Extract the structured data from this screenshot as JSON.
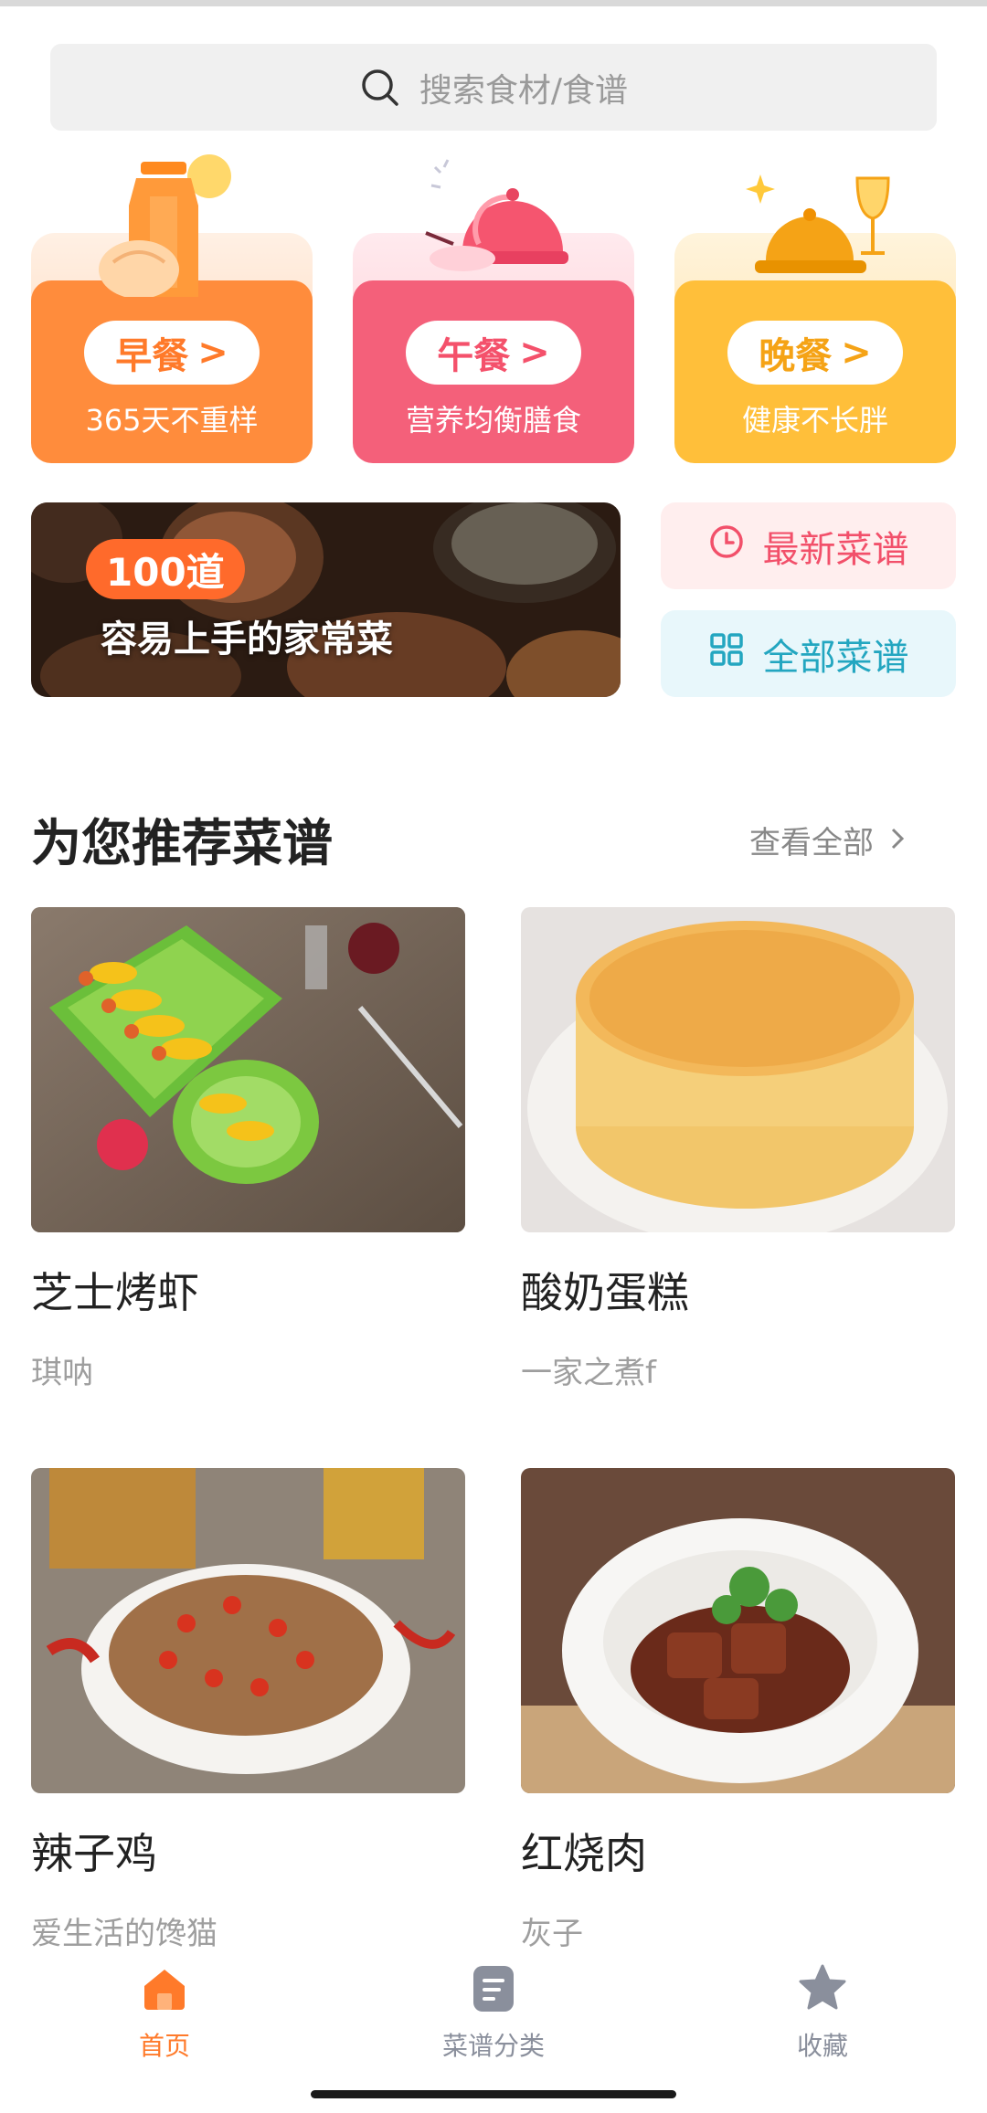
{
  "search": {
    "placeholder": "搜索食材/食谱"
  },
  "meals": [
    {
      "label": "早餐",
      "subtitle": "365天不重样",
      "color": "#ff8c3c",
      "text_color": "#ff7a2a"
    },
    {
      "label": "午餐",
      "subtitle": "营养均衡膳食",
      "color": "#f4607a",
      "text_color": "#f4516b"
    },
    {
      "label": "晚餐",
      "subtitle": "健康不长胖",
      "color": "#ffbf3a",
      "text_color": "#f5a316"
    }
  ],
  "banner": {
    "badge": "100道",
    "caption": "容易上手的家常菜"
  },
  "quick_links": {
    "newest": "最新菜谱",
    "all": "全部菜谱"
  },
  "section": {
    "title": "为您推荐菜谱",
    "see_all": "查看全部"
  },
  "recipes": [
    {
      "name": "芝士烤虾",
      "author": "琪呐"
    },
    {
      "name": "酸奶蛋糕",
      "author": "一家之煮f"
    },
    {
      "name": "辣子鸡",
      "author": "爱生活的馋猫"
    },
    {
      "name": "红烧肉",
      "author": "灰子"
    }
  ],
  "tabbar": {
    "active_color": "#ff7a2a",
    "inactive_color": "#8a8f9c",
    "items": [
      {
        "label": "首页",
        "icon": "home-icon"
      },
      {
        "label": "菜谱分类",
        "icon": "recipe-category-icon"
      },
      {
        "label": "收藏",
        "icon": "star-icon"
      }
    ]
  }
}
